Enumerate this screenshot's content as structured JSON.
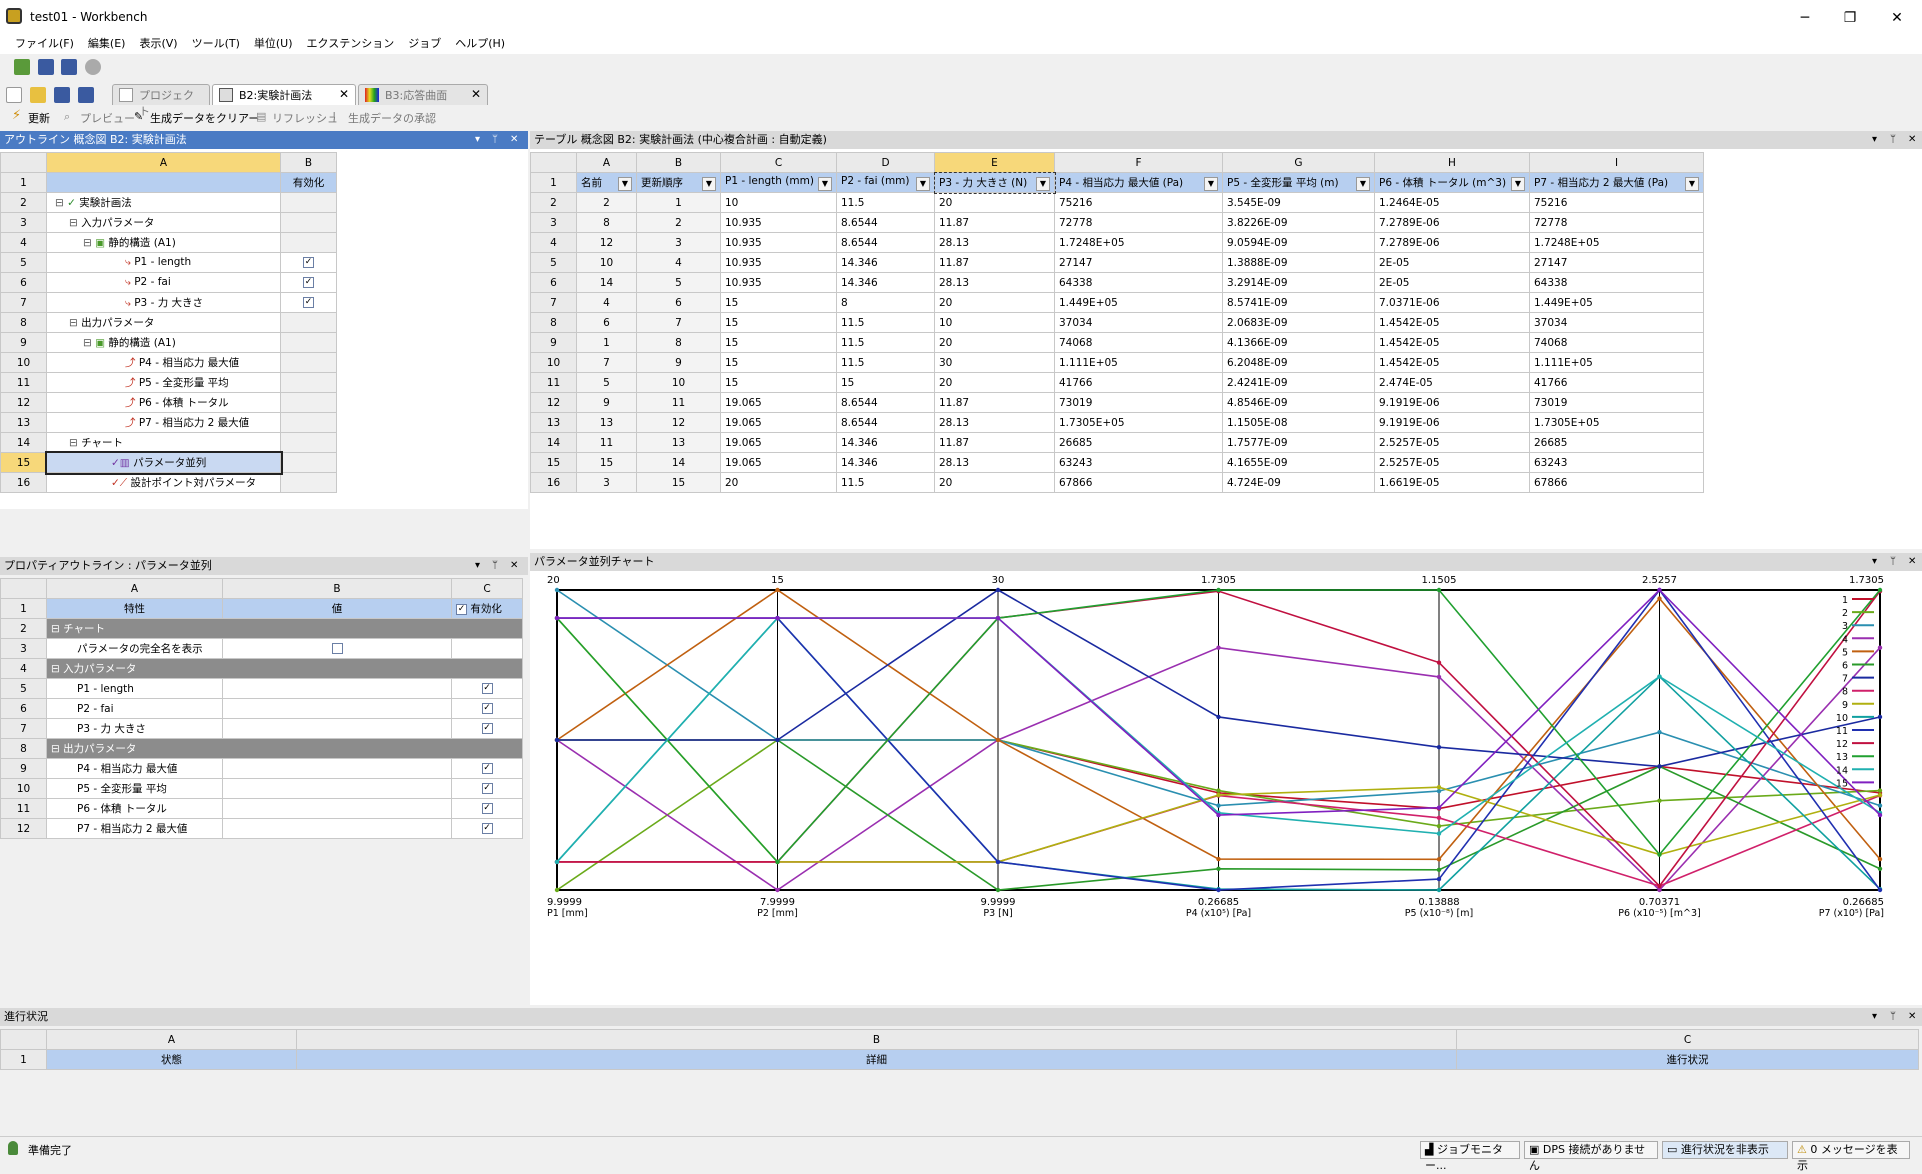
{
  "window": {
    "title": "test01 - Workbench",
    "min": "─",
    "max": "❐",
    "close": "✕"
  },
  "menu": [
    "ファイル(F)",
    "編集(E)",
    "表示(V)",
    "ツール(T)",
    "単位(U)",
    "エクステンション",
    "ジョブ",
    "ヘルプ(H)"
  ],
  "tabs": [
    {
      "label": "プロジェクト"
    },
    {
      "label": "B2:実験計画法"
    },
    {
      "label": "B3:応答曲面"
    }
  ],
  "toolbar2": {
    "update": "更新",
    "preview": "プレビュー",
    "clear": "生成データをクリアー",
    "refresh": "リフレッシュ",
    "approve": "生成データの承認"
  },
  "outline": {
    "title": "アウトライン 概念図 B2: 実験計画法",
    "col_a": "A",
    "col_b": "B",
    "enable": "有効化",
    "rows": [
      {
        "n": "1",
        "label": "",
        "b": "有効化"
      },
      {
        "n": "2",
        "label": "実験計画法",
        "b": ""
      },
      {
        "n": "3",
        "label": "入力パラメータ",
        "b": ""
      },
      {
        "n": "4",
        "label": "静的構造 (A1)",
        "b": ""
      },
      {
        "n": "5",
        "label": "P1 - length",
        "b": "☑"
      },
      {
        "n": "6",
        "label": "P2 - fai",
        "b": "☑"
      },
      {
        "n": "7",
        "label": "P3 - 力 大きさ",
        "b": "☑"
      },
      {
        "n": "8",
        "label": "出力パラメータ",
        "b": ""
      },
      {
        "n": "9",
        "label": "静的構造 (A1)",
        "b": ""
      },
      {
        "n": "10",
        "label": "P4 - 相当応力 最大値",
        "b": ""
      },
      {
        "n": "11",
        "label": "P5 - 全変形量 平均",
        "b": ""
      },
      {
        "n": "12",
        "label": "P6 - 体積 トータル",
        "b": ""
      },
      {
        "n": "13",
        "label": "P7 - 相当応力 2 最大値",
        "b": ""
      },
      {
        "n": "14",
        "label": "チャート",
        "b": ""
      },
      {
        "n": "15",
        "label": "パラメータ並列",
        "b": ""
      },
      {
        "n": "16",
        "label": "設計ポイント対パラメータ",
        "b": ""
      }
    ]
  },
  "table": {
    "title": "テーブル 概念図 B2: 実験計画法 (中心複合計画 : 自動定義)",
    "cols": [
      "A",
      "B",
      "C",
      "D",
      "E",
      "F",
      "G",
      "H",
      "I"
    ],
    "headers": [
      "名前",
      "更新順序",
      "P1 - length (mm)",
      "P2 - fai (mm)",
      "P3 - 力 大きさ (N)",
      "P4 - 相当応力 最大値 (Pa)",
      "P5 - 全変形量 平均 (m)",
      "P6 - 体積 トータル (m^3)",
      "P7 - 相当応力 2 最大値 (Pa)"
    ],
    "rows": [
      [
        "2",
        "1",
        "10",
        "11.5",
        "20",
        "75216",
        "3.545E-09",
        "1.2464E-05",
        "75216"
      ],
      [
        "8",
        "2",
        "10.935",
        "8.6544",
        "11.87",
        "72778",
        "3.8226E-09",
        "7.2789E-06",
        "72778"
      ],
      [
        "12",
        "3",
        "10.935",
        "8.6544",
        "28.13",
        "1.7248E+05",
        "9.0594E-09",
        "7.2789E-06",
        "1.7248E+05"
      ],
      [
        "10",
        "4",
        "10.935",
        "14.346",
        "11.87",
        "27147",
        "1.3888E-09",
        "2E-05",
        "27147"
      ],
      [
        "14",
        "5",
        "10.935",
        "14.346",
        "28.13",
        "64338",
        "3.2914E-09",
        "2E-05",
        "64338"
      ],
      [
        "4",
        "6",
        "15",
        "8",
        "20",
        "1.449E+05",
        "8.5741E-09",
        "7.0371E-06",
        "1.449E+05"
      ],
      [
        "6",
        "7",
        "15",
        "11.5",
        "10",
        "37034",
        "2.0683E-09",
        "1.4542E-05",
        "37034"
      ],
      [
        "1",
        "8",
        "15",
        "11.5",
        "20",
        "74068",
        "4.1366E-09",
        "1.4542E-05",
        "74068"
      ],
      [
        "7",
        "9",
        "15",
        "11.5",
        "30",
        "1.111E+05",
        "6.2048E-09",
        "1.4542E-05",
        "1.111E+05"
      ],
      [
        "5",
        "10",
        "15",
        "15",
        "20",
        "41766",
        "2.4241E-09",
        "2.474E-05",
        "41766"
      ],
      [
        "9",
        "11",
        "19.065",
        "8.6544",
        "11.87",
        "73019",
        "4.8546E-09",
        "9.1919E-06",
        "73019"
      ],
      [
        "13",
        "12",
        "19.065",
        "8.6544",
        "28.13",
        "1.7305E+05",
        "1.1505E-08",
        "9.1919E-06",
        "1.7305E+05"
      ],
      [
        "11",
        "13",
        "19.065",
        "14.346",
        "11.87",
        "26685",
        "1.7577E-09",
        "2.5257E-05",
        "26685"
      ],
      [
        "15",
        "14",
        "19.065",
        "14.346",
        "28.13",
        "63243",
        "4.1655E-09",
        "2.5257E-05",
        "63243"
      ],
      [
        "3",
        "15",
        "20",
        "11.5",
        "20",
        "67866",
        "4.724E-09",
        "1.6619E-05",
        "67866"
      ]
    ]
  },
  "props": {
    "title": "プロパティアウトライン : パラメータ並列",
    "cols": [
      "A",
      "B",
      "C"
    ],
    "h_a": "特性",
    "h_b": "値",
    "h_c": "有効化",
    "rows": [
      {
        "n": "2",
        "t": "sec",
        "a": "チャート"
      },
      {
        "n": "3",
        "t": "row",
        "a": "パラメータの完全名を表示",
        "b": "☐"
      },
      {
        "n": "4",
        "t": "sec",
        "a": "入力パラメータ"
      },
      {
        "n": "5",
        "t": "row",
        "a": "P1 - length",
        "c": "☑"
      },
      {
        "n": "6",
        "t": "row",
        "a": "P2 - fai",
        "c": "☑"
      },
      {
        "n": "7",
        "t": "row",
        "a": "P3 - 力 大きさ",
        "c": "☑"
      },
      {
        "n": "8",
        "t": "sec",
        "a": "出力パラメータ"
      },
      {
        "n": "9",
        "t": "row",
        "a": "P4 - 相当応力 最大値",
        "c": "☑"
      },
      {
        "n": "10",
        "t": "row",
        "a": "P5 - 全変形量 平均",
        "c": "☑"
      },
      {
        "n": "11",
        "t": "row",
        "a": "P6 - 体積 トータル",
        "c": "☑"
      },
      {
        "n": "12",
        "t": "row",
        "a": "P7 - 相当応力 2 最大値",
        "c": "☑"
      }
    ]
  },
  "chart_data": {
    "type": "line",
    "title": "パラメータ並列チャート",
    "axes": [
      {
        "top": "20",
        "bottom": "9.9999",
        "label": "P1 [mm]"
      },
      {
        "top": "15",
        "bottom": "7.9999",
        "label": "P2 [mm]"
      },
      {
        "top": "30",
        "bottom": "9.9999",
        "label": "P3 [N]"
      },
      {
        "top": "1.7305",
        "bottom": "0.26685",
        "label": "P4 (x10⁵) [Pa]"
      },
      {
        "top": "1.1505",
        "bottom": "0.13888",
        "label": "P5 (x10⁻⁸) [m]"
      },
      {
        "top": "2.5257",
        "bottom": "0.70371",
        "label": "P6 (x10⁻⁵) [m^3]"
      },
      {
        "top": "1.7305",
        "bottom": "0.26685",
        "label": "P7 (x10⁵) [Pa]"
      }
    ],
    "ranges": [
      [
        9.9999,
        20
      ],
      [
        7.9999,
        15
      ],
      [
        9.9999,
        30
      ],
      [
        26685,
        173050
      ],
      [
        1.3888e-09,
        1.1505e-08
      ],
      [
        7.0371e-06,
        2.5257e-05
      ],
      [
        26685,
        173050
      ]
    ],
    "legend": [
      "1",
      "2",
      "3",
      "4",
      "5",
      "6",
      "7",
      "8",
      "9",
      "10",
      "11",
      "12",
      "13",
      "14",
      "15"
    ],
    "colors": [
      "#c0102a",
      "#6aaa1a",
      "#2a8fb0",
      "#9a2fb0",
      "#c06010",
      "#2a9a2a",
      "#1a2aa0",
      "#d0206a",
      "#b0b010",
      "#10a0a0",
      "#2030b0",
      "#c01040",
      "#20a030",
      "#20b0b0",
      "#8020c0"
    ],
    "series": [
      {
        "name": "1",
        "values": [
          15,
          11.5,
          20,
          74068,
          4.1366e-09,
          1.4542e-05,
          74068
        ]
      },
      {
        "name": "2",
        "values": [
          10,
          11.5,
          20,
          75216,
          3.545e-09,
          1.2464e-05,
          75216
        ]
      },
      {
        "name": "3",
        "values": [
          20,
          11.5,
          20,
          67866,
          4.724e-09,
          1.6619e-05,
          67866
        ]
      },
      {
        "name": "4",
        "values": [
          15,
          8,
          20,
          144900,
          8.5741e-09,
          7.0371e-06,
          144900
        ]
      },
      {
        "name": "5",
        "values": [
          15,
          15,
          20,
          41766,
          2.4241e-09,
          2.474e-05,
          41766
        ]
      },
      {
        "name": "6",
        "values": [
          15,
          11.5,
          10,
          37034,
          2.0683e-09,
          1.4542e-05,
          37034
        ]
      },
      {
        "name": "7",
        "values": [
          15,
          11.5,
          30,
          111100,
          6.2048e-09,
          1.4542e-05,
          111100
        ]
      },
      {
        "name": "8",
        "values": [
          10.935,
          8.6544,
          11.87,
          72778,
          3.8226e-09,
          7.2789e-06,
          72778
        ]
      },
      {
        "name": "9",
        "values": [
          19.065,
          8.6544,
          11.87,
          73019,
          4.8546e-09,
          9.1919e-06,
          73019
        ]
      },
      {
        "name": "10",
        "values": [
          10.935,
          14.346,
          11.87,
          27147,
          1.3888e-09,
          2e-05,
          27147
        ]
      },
      {
        "name": "11",
        "values": [
          19.065,
          14.346,
          11.87,
          26685,
          1.7577e-09,
          2.5257e-05,
          26685
        ]
      },
      {
        "name": "12",
        "values": [
          10.935,
          8.6544,
          28.13,
          172480,
          9.0594e-09,
          7.2789e-06,
          172480
        ]
      },
      {
        "name": "13",
        "values": [
          19.065,
          8.6544,
          28.13,
          173050,
          1.1505e-08,
          9.1919e-06,
          173050
        ]
      },
      {
        "name": "14",
        "values": [
          10.935,
          14.346,
          28.13,
          64338,
          3.2914e-09,
          2e-05,
          64338
        ]
      },
      {
        "name": "15",
        "values": [
          19.065,
          14.346,
          28.13,
          63243,
          4.1655e-09,
          2.5257e-05,
          63243
        ]
      }
    ]
  },
  "progress": {
    "title": "進行状況",
    "cols": [
      "A",
      "B",
      "C"
    ],
    "h": [
      "状態",
      "詳細",
      "進行状況"
    ]
  },
  "status": {
    "ready": "準備完了",
    "job": "ジョブモニター...",
    "dps": "DPS 接続がありません",
    "hide": "進行状況を非表示",
    "msgs": "0 メッセージを表示"
  }
}
